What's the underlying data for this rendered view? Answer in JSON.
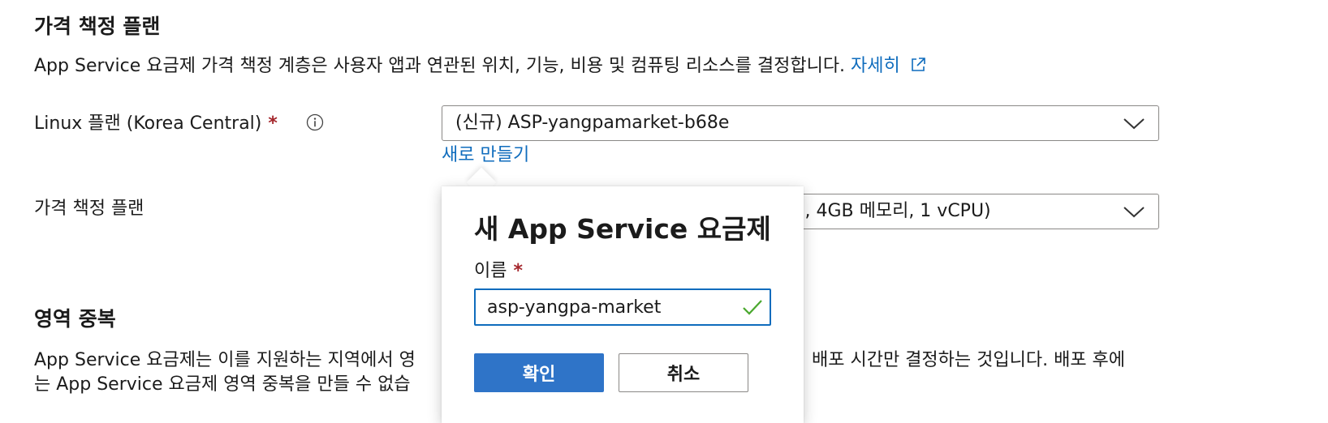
{
  "pricing_section": {
    "heading": "가격 책정 플랜",
    "description": "App Service 요금제 가격 책정 계층은 사용자 앱과 연관된 위치, 기능, 비용 및 컴퓨팅 리소스를 결정합니다.",
    "learn_more": "자세히",
    "linux_plan_label": "Linux 플랜 (Korea Central)",
    "required_mark": "*",
    "linux_plan_value": "(신규) ASP-yangpamarket-b68e",
    "create_new": "새로 만들기",
    "pricing_plan_label": "가격 책정 플랜",
    "pricing_plan_value": "J, 4GB 메모리, 1 vCPU)"
  },
  "zone_section": {
    "heading": "영역 중복",
    "description_line1_a": "App Service 요금제는 이를 지원하는 지역에서 영",
    "description_line1_b": "배포 시간만 결정하는 것입니다. 배포 후에",
    "description_line2": "는 App Service 요금제 영역 중복을 만들 수 없습"
  },
  "callout": {
    "title": "새 App Service 요금제",
    "name_label": "이름",
    "required_mark": "*",
    "name_value": "asp-yangpa-market",
    "ok_label": "확인",
    "cancel_label": "취소"
  },
  "colors": {
    "link": "#0f6cbd",
    "primary_button": "#2f74c8",
    "required": "#a4262c",
    "valid_check": "#4aa82e"
  },
  "icons": [
    "info-icon",
    "external-link-icon",
    "chevron-down-icon",
    "checkmark-icon"
  ]
}
